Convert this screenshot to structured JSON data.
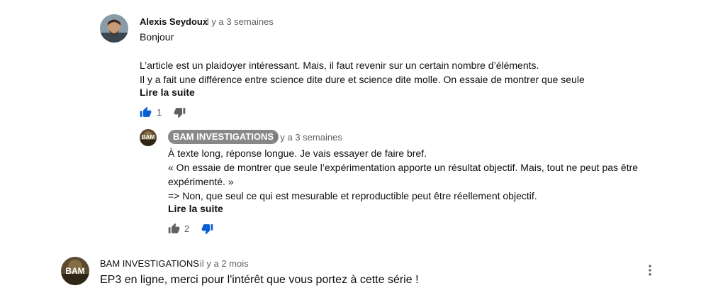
{
  "comments": [
    {
      "author": "Alexis Seydoux",
      "time": "il y a 3 semaines",
      "lines": [
        "Bonjour",
        "",
        "L’article est un plaidoyer intéressant. Mais, il faut revenir sur un certain nombre d’éléments.",
        "Il y a fait une différence entre science dite dure et science dite molle. On essaie de montrer que seule"
      ],
      "read_more": "Lire la suite",
      "likes": "1",
      "reply": {
        "author": "BAM INVESTIGATIONS",
        "time": "il y a 3 semaines",
        "lines": [
          "À texte long, réponse longue. Je vais essayer de faire bref.",
          "« On essaie de montrer que seule l’expérimentation apporte un résultat objectif. Mais, tout ne peut pas être",
          "expérimenté. »",
          "=> Non, que seul ce qui est mesurable et reproductible peut être réellement objectif."
        ],
        "read_more": "Lire la suite",
        "likes": "2",
        "avatar_text": "BAM"
      }
    },
    {
      "author": "BAM INVESTIGATIONS",
      "time": "il y a 2 mois",
      "text": "EP3 en ligne, merci pour l'intérêt que vous portez à cette série !",
      "avatar_text": "BAM"
    }
  ],
  "colors": {
    "like_active": "#065fd4",
    "icon_gray": "#606060",
    "badge_bg": "#888888"
  }
}
